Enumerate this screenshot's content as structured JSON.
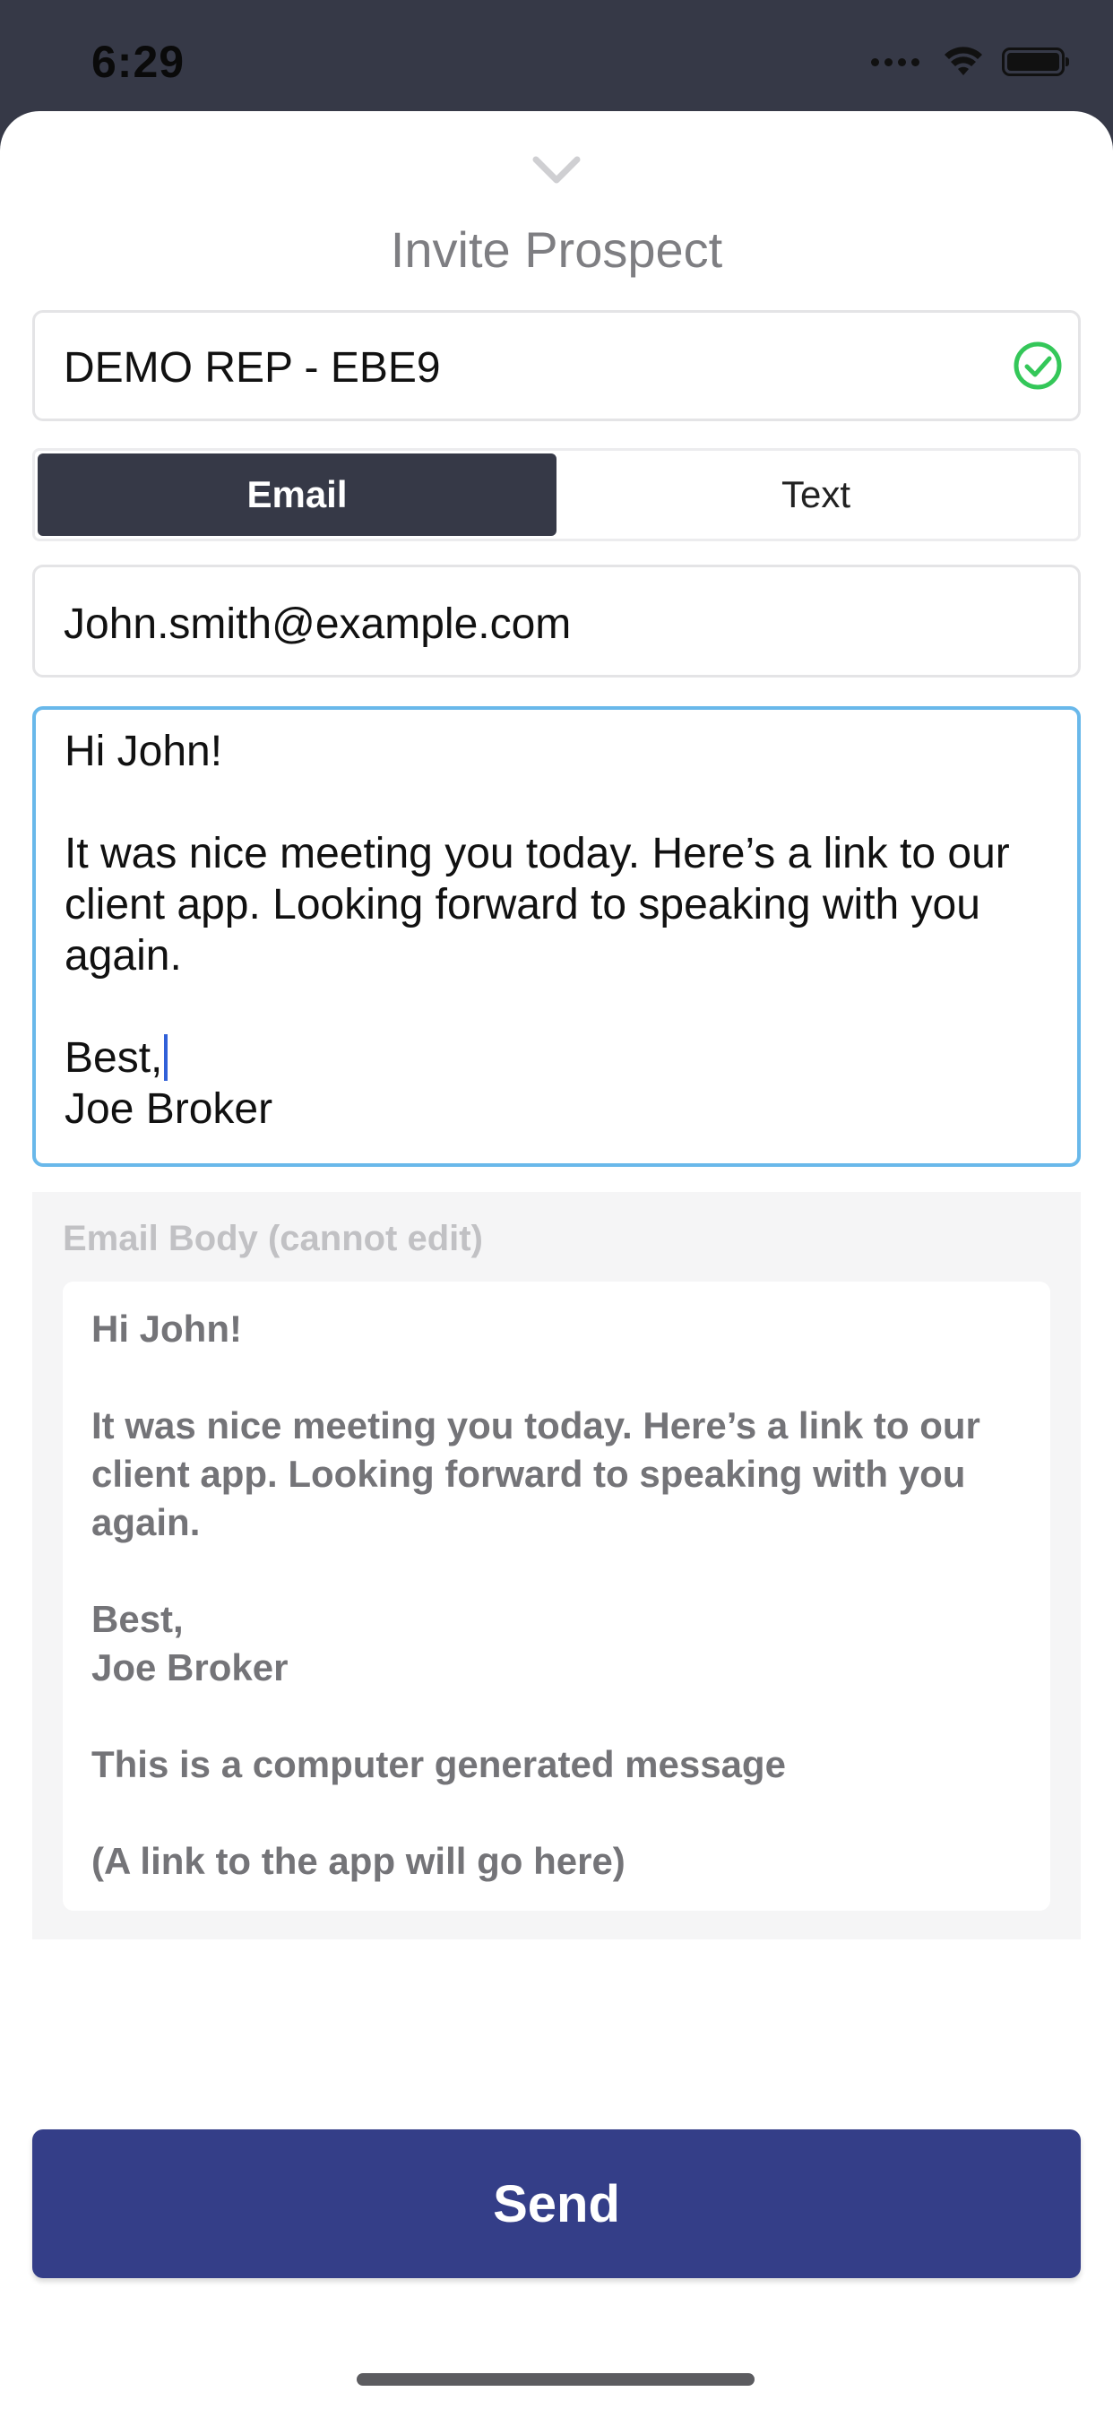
{
  "status_bar": {
    "time": "6:29"
  },
  "sheet": {
    "title": "Invite Prospect"
  },
  "rep": {
    "value": "DEMO REP - EBE9",
    "status_icon": "check-circle-icon",
    "status_color": "#34c759"
  },
  "tabs": {
    "email_label": "Email",
    "text_label": "Text",
    "selected": "Email"
  },
  "email": {
    "value": "John.smith@example.com"
  },
  "message": {
    "body_before_cursor": "Hi John!\n\nIt was nice meeting you today. Here’s a link to our client app. Looking forward to speaking with you again.\n\nBest,",
    "body_after_cursor": "\nJoe Broker"
  },
  "preview": {
    "label": "Email Body (cannot edit)",
    "body": "Hi John!\n\nIt was nice meeting you today. Here’s a link to our client app. Looking forward to speaking with you again.\n\nBest,\nJoe Broker\n\nThis is a computer generated message\n\n(A link to the app will go here)"
  },
  "actions": {
    "send_label": "Send"
  },
  "colors": {
    "header_dark": "#363947",
    "accent_blue": "#343e88",
    "focus_border": "#69b8ea"
  }
}
